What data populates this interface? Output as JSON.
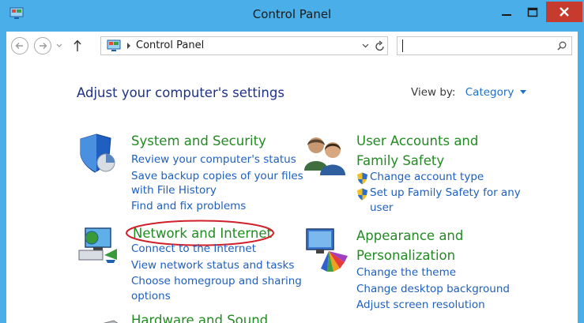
{
  "window": {
    "title": "Control Panel"
  },
  "address_bar": {
    "breadcrumb": "Control Panel",
    "search_value": ""
  },
  "main": {
    "heading": "Adjust your computer's settings",
    "view_by_label": "View by:",
    "view_by_value": "Category",
    "categories": [
      {
        "title": "System and Security",
        "icon": "shield-icon",
        "links": [
          "Review your computer's status",
          "Save backup copies of your files",
          "with File History",
          "Find and fix problems"
        ]
      },
      {
        "title": "User Accounts and",
        "title2": "Family Safety",
        "icon": "users-icon",
        "links": [
          "Change account type",
          "Set up Family Safety for any",
          "user"
        ]
      },
      {
        "title": "Network and Internet",
        "icon": "network-icon",
        "highlighted": true,
        "links": [
          "Connect to the Internet",
          "View network status and tasks",
          "Choose homegroup and sharing",
          "options"
        ]
      },
      {
        "title": "Appearance and",
        "title2": "Personalization",
        "icon": "appearance-icon",
        "links": [
          "Change the theme",
          "Change desktop background",
          "Adjust screen resolution"
        ]
      },
      {
        "title": "Hardware and Sound",
        "icon": "hardware-icon",
        "links": []
      }
    ]
  },
  "colors": {
    "frame": "#4aaee8",
    "close_button": "#c73a2e",
    "category_title": "#228b22",
    "link": "#1e5fbf",
    "heading": "#1e3287",
    "highlight_circle": "#d0202a"
  }
}
